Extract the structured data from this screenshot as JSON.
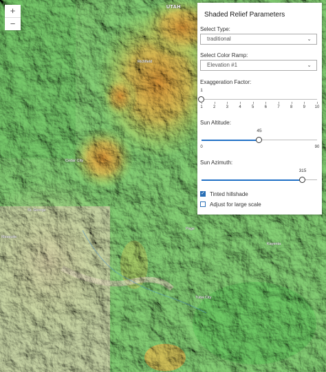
{
  "map": {
    "labels": [
      {
        "text": "UTAH",
        "kind": "state"
      },
      {
        "text": "Richfield",
        "kind": "city"
      },
      {
        "text": "Cedar City",
        "kind": "city"
      },
      {
        "text": "St. George",
        "kind": "city"
      },
      {
        "text": "Page",
        "kind": "city"
      },
      {
        "text": "Kayenta",
        "kind": "city"
      },
      {
        "text": "Tuba City",
        "kind": "city"
      },
      {
        "text": "Mesquite",
        "kind": "city"
      }
    ]
  },
  "zoom": {
    "in_label": "+",
    "out_label": "−"
  },
  "panel": {
    "title": "Shaded Relief Parameters",
    "type_label": "Select Type:",
    "type_value": "traditional",
    "ramp_label": "Select Color Ramp:",
    "ramp_value": "Elevation #1",
    "exaggeration": {
      "label": "Exaggeration Factor:",
      "value": 1,
      "min": 1,
      "max": 10,
      "ticks": [
        "1",
        "2",
        "3",
        "4",
        "5",
        "6",
        "7",
        "8",
        "9",
        "10"
      ]
    },
    "altitude": {
      "label": "Sun Altitude:",
      "value": 45,
      "min": 0,
      "max": 90,
      "min_label": "0",
      "max_label": "90"
    },
    "azimuth": {
      "label": "Sun Azimuth:",
      "value": 315,
      "min": 0,
      "max": 360
    },
    "tinted": {
      "label": "Tinted hillshade",
      "checked": true
    },
    "large_scale": {
      "label": "Adjust for large scale",
      "checked": false
    }
  },
  "colors": {
    "accent": "#1f6fc5",
    "checkbox": "#2a6fb5"
  }
}
